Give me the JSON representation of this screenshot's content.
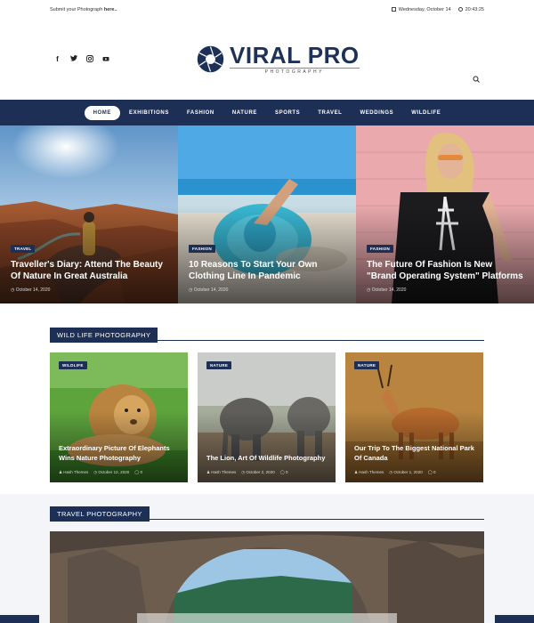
{
  "topbar": {
    "submit_prefix": "Submit your Photograph",
    "submit_link": "here..",
    "date": "Wednesday, October 14",
    "time": "20:43:25"
  },
  "header": {
    "social_icons": [
      "facebook-icon",
      "twitter-icon",
      "instagram-icon",
      "youtube-icon"
    ],
    "logo_name": "VIRAL PRO",
    "logo_sub": "PHOTOGRAPHY"
  },
  "nav": {
    "items": [
      "HOME",
      "EXHIBITIONS",
      "FASHION",
      "NATURE",
      "SPORTS",
      "TRAVEL",
      "WEDDINGS",
      "WILDLIFE"
    ],
    "active": "HOME"
  },
  "hero": [
    {
      "category": "TRAVEL",
      "title": "Traveller's Diary: Attend The Beauty Of Nature In Great Australia",
      "date": "October 14, 2020"
    },
    {
      "category": "FASHION",
      "title": "10 Reasons To Start Your Own Clothing Line In Pandemic",
      "date": "October 14, 2020"
    },
    {
      "category": "FASHION",
      "title": "The Future Of Fashion Is New \"Brand Operating System\" Platforms",
      "date": "October 14, 2020"
    }
  ],
  "wildlife": {
    "heading": "WILD LIFE PHOTOGRAPHY",
    "cards": [
      {
        "category": "WILDLIFE",
        "title": "Extraordinary Picture Of Elephants Wins Nature Photography",
        "author": "Hash Themes",
        "date": "October 12, 2020",
        "comments": "0"
      },
      {
        "category": "NATURE",
        "title": "The Lion, Art Of Wildlife Photography",
        "author": "Hash Themes",
        "date": "October 2, 2020",
        "comments": "0"
      },
      {
        "category": "NATURE",
        "title": "Our Trip To The Biggest National Park Of Canada",
        "author": "Hash Themes",
        "date": "October 1, 2020",
        "comments": "0"
      }
    ]
  },
  "travel": {
    "heading": "TRAVEL PHOTOGRAPHY"
  },
  "colors": {
    "brand": "#1e2f55"
  }
}
